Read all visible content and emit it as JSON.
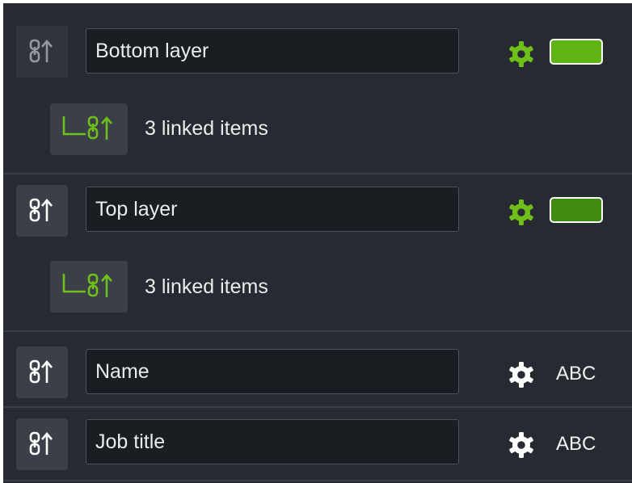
{
  "layers": [
    {
      "name": "Bottom layer",
      "linked_label": "3 linked items",
      "swatch_color": "#5fb414",
      "link_state": "inactive"
    },
    {
      "name": "Top layer",
      "linked_label": "3 linked items",
      "swatch_color": "#3f8c10",
      "link_state": "active"
    }
  ],
  "fields": [
    {
      "name": "Name",
      "type_label": "ABC"
    },
    {
      "name": "Job title",
      "type_label": "ABC"
    }
  ],
  "colors": {
    "accent_green": "#6fbf1a",
    "panel_bg": "#272b31",
    "input_bg": "#1a1d21",
    "icon_white": "#ffffff"
  },
  "icons": [
    "link-up-icon",
    "linked-branch-icon",
    "gear-icon"
  ]
}
